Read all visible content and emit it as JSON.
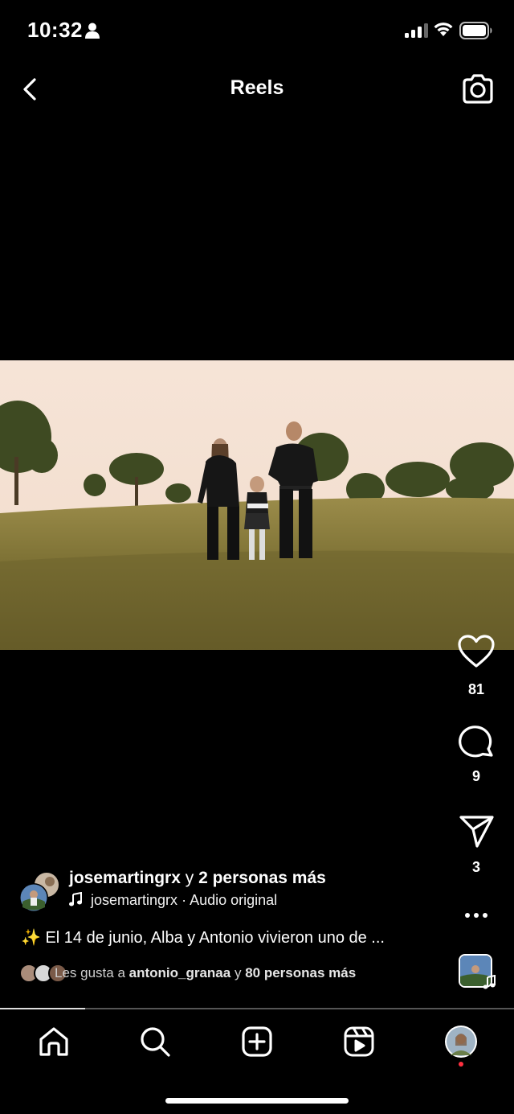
{
  "status_bar": {
    "time": "10:32",
    "icons": [
      "person-icon",
      "cellular-signal-icon",
      "wifi-icon",
      "battery-icon"
    ]
  },
  "header": {
    "title": "Reels",
    "back_icon": "chevron-left-icon",
    "camera_icon": "camera-icon"
  },
  "actions": {
    "like_count": "81",
    "comment_count": "9",
    "share_count": "3",
    "more_icon": "more-horizontal-icon"
  },
  "post": {
    "author": "josemartingrx",
    "author_connector": "y",
    "author_extra": "2 personas más",
    "audio_author": "josemartingrx",
    "audio_separator": "·",
    "audio_title": "Audio original",
    "caption_emoji": "✨",
    "caption": "El 14 de junio, Alba y Antonio vivieron uno de ...",
    "likes_prefix": "Les gusta a",
    "likes_user": "antonio_granaa",
    "likes_connector": "y",
    "likes_others": "80 personas más"
  },
  "playback": {
    "progress": 0.165
  },
  "tab_bar": {
    "items": [
      "home-icon",
      "search-icon",
      "create-icon",
      "reels-icon",
      "profile-avatar"
    ],
    "active_indicator_color": "#ff3040"
  }
}
